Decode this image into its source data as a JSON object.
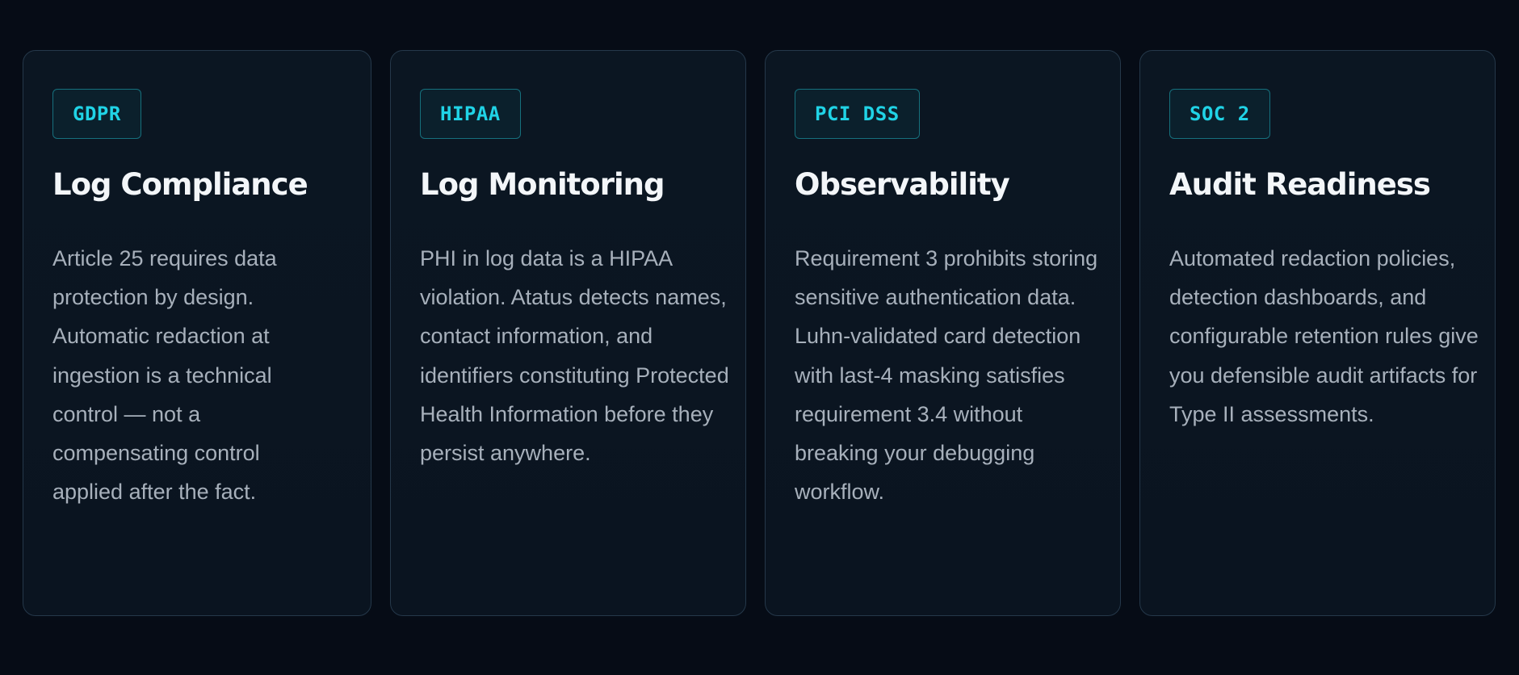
{
  "cards": [
    {
      "badge": "GDPR",
      "title": "Log Compliance",
      "description": "Article 25 requires data protection by design. Automatic redaction at ingestion is a technical control — not a compensating control applied after the fact."
    },
    {
      "badge": "HIPAA",
      "title": "Log Monitoring",
      "description": "PHI in log data is a HIPAA violation. Atatus detects names, contact information, and identifiers constituting Protected Health Information before they persist anywhere."
    },
    {
      "badge": "PCI DSS",
      "title": "Observability",
      "description": "Requirement 3 prohibits storing sensitive authentication data. Luhn-validated card detection with last-4 masking satisfies requirement 3.4 without breaking your debugging workflow."
    },
    {
      "badge": "SOC 2",
      "title": "Audit Readiness",
      "description": "Automated redaction policies, detection dashboards, and configurable retention rules give you defensible audit artifacts for Type II assessments."
    }
  ],
  "colors": {
    "background": "#060c16",
    "card_background": "#0b1622",
    "card_border": "#25384a",
    "accent": "#20d3e6",
    "title": "#f3f6f9",
    "body_text": "#a7b0bb"
  }
}
